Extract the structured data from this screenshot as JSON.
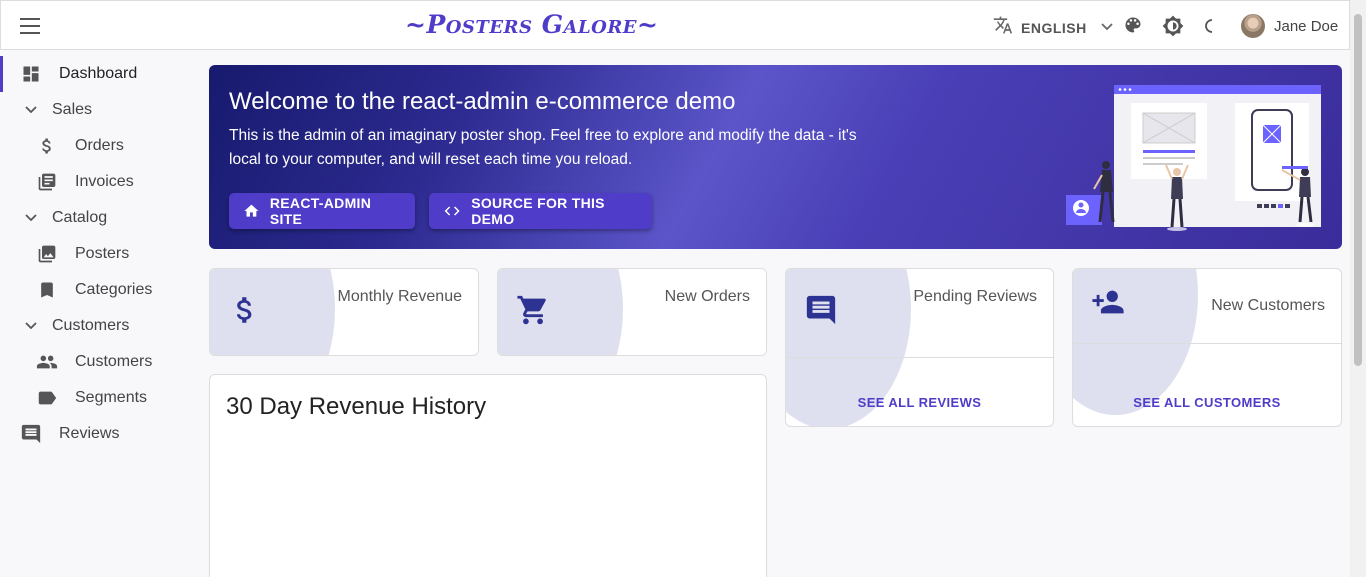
{
  "header": {
    "title": "~Posters Galore~",
    "language": "ENGLISH",
    "user_name": "Jane Doe"
  },
  "sidebar": {
    "items": [
      {
        "label": "Dashboard",
        "icon": "dashboard-icon"
      },
      {
        "label": "Sales",
        "icon": "chevron-down-icon"
      },
      {
        "label": "Orders",
        "icon": "dollar-icon"
      },
      {
        "label": "Invoices",
        "icon": "invoices-icon"
      },
      {
        "label": "Catalog",
        "icon": "chevron-down-icon"
      },
      {
        "label": "Posters",
        "icon": "image-icon"
      },
      {
        "label": "Categories",
        "icon": "bookmark-icon"
      },
      {
        "label": "Customers",
        "icon": "chevron-down-icon"
      },
      {
        "label": "Customers",
        "icon": "people-icon"
      },
      {
        "label": "Segments",
        "icon": "label-icon"
      },
      {
        "label": "Reviews",
        "icon": "comment-icon"
      }
    ]
  },
  "banner": {
    "title": "Welcome to the react-admin e-commerce demo",
    "text": "This is the admin of an imaginary poster shop. Feel free to explore and modify the data - it's local to your computer, and will reset each time you reload.",
    "button_site": "REACT-ADMIN SITE",
    "button_source": "SOURCE FOR THIS DEMO"
  },
  "stats": {
    "monthly_revenue": {
      "label": "Monthly Revenue",
      "value": ""
    },
    "new_orders": {
      "label": "New Orders",
      "value": ""
    },
    "pending_reviews": {
      "label": "Pending Reviews",
      "value": "",
      "link": "SEE ALL REVIEWS"
    },
    "new_customers": {
      "label": "New Customers",
      "value": "",
      "link": "SEE ALL CUSTOMERS"
    }
  },
  "revenue_history": {
    "title": "30 Day Revenue History"
  },
  "colors": {
    "primary": "#4f3cc9",
    "icon_dark": "#2d3392",
    "blob": "#dfe0ef"
  }
}
